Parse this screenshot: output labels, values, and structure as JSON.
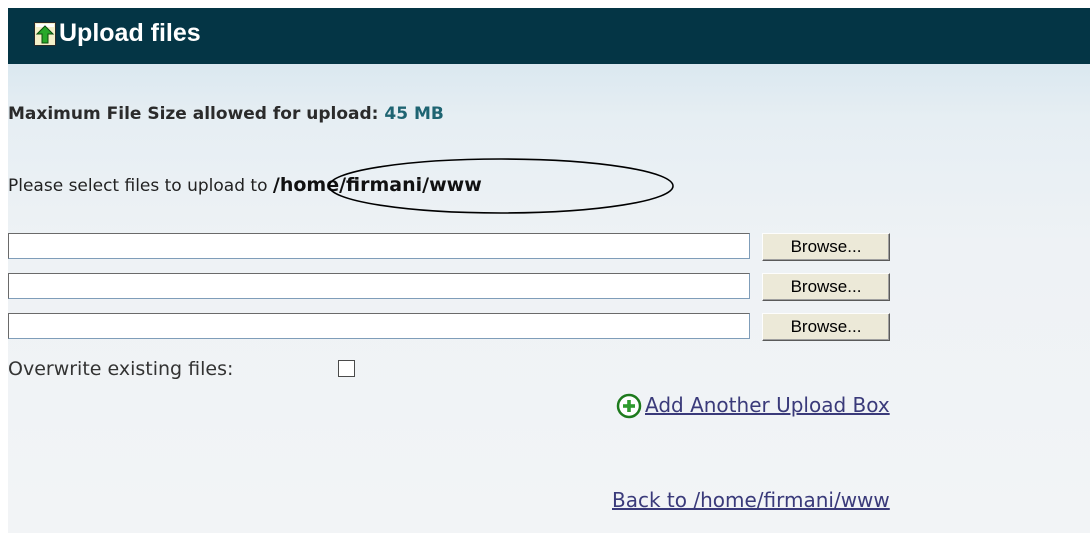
{
  "header": {
    "title": "Upload files",
    "icon": "upload-arrow-icon"
  },
  "limits": {
    "label": "Maximum File Size allowed for upload:",
    "value": "45 MB"
  },
  "destination": {
    "prefix": "Please select files to upload to",
    "path": "/home/firmani/www"
  },
  "uploads": [
    {
      "value": "",
      "browse_label": "Browse..."
    },
    {
      "value": "",
      "browse_label": "Browse..."
    },
    {
      "value": "",
      "browse_label": "Browse..."
    }
  ],
  "overwrite": {
    "label": "Overwrite existing files:",
    "checked": false
  },
  "links": {
    "add_box": "Add Another Upload Box",
    "add_icon": "plus-circle-icon",
    "back": "Back to /home/firmani/www"
  },
  "colors": {
    "header_bg": "#043545",
    "size_value": "#1e6472",
    "link": "#3a3a7a",
    "icon_green": "#2e9a2e"
  }
}
